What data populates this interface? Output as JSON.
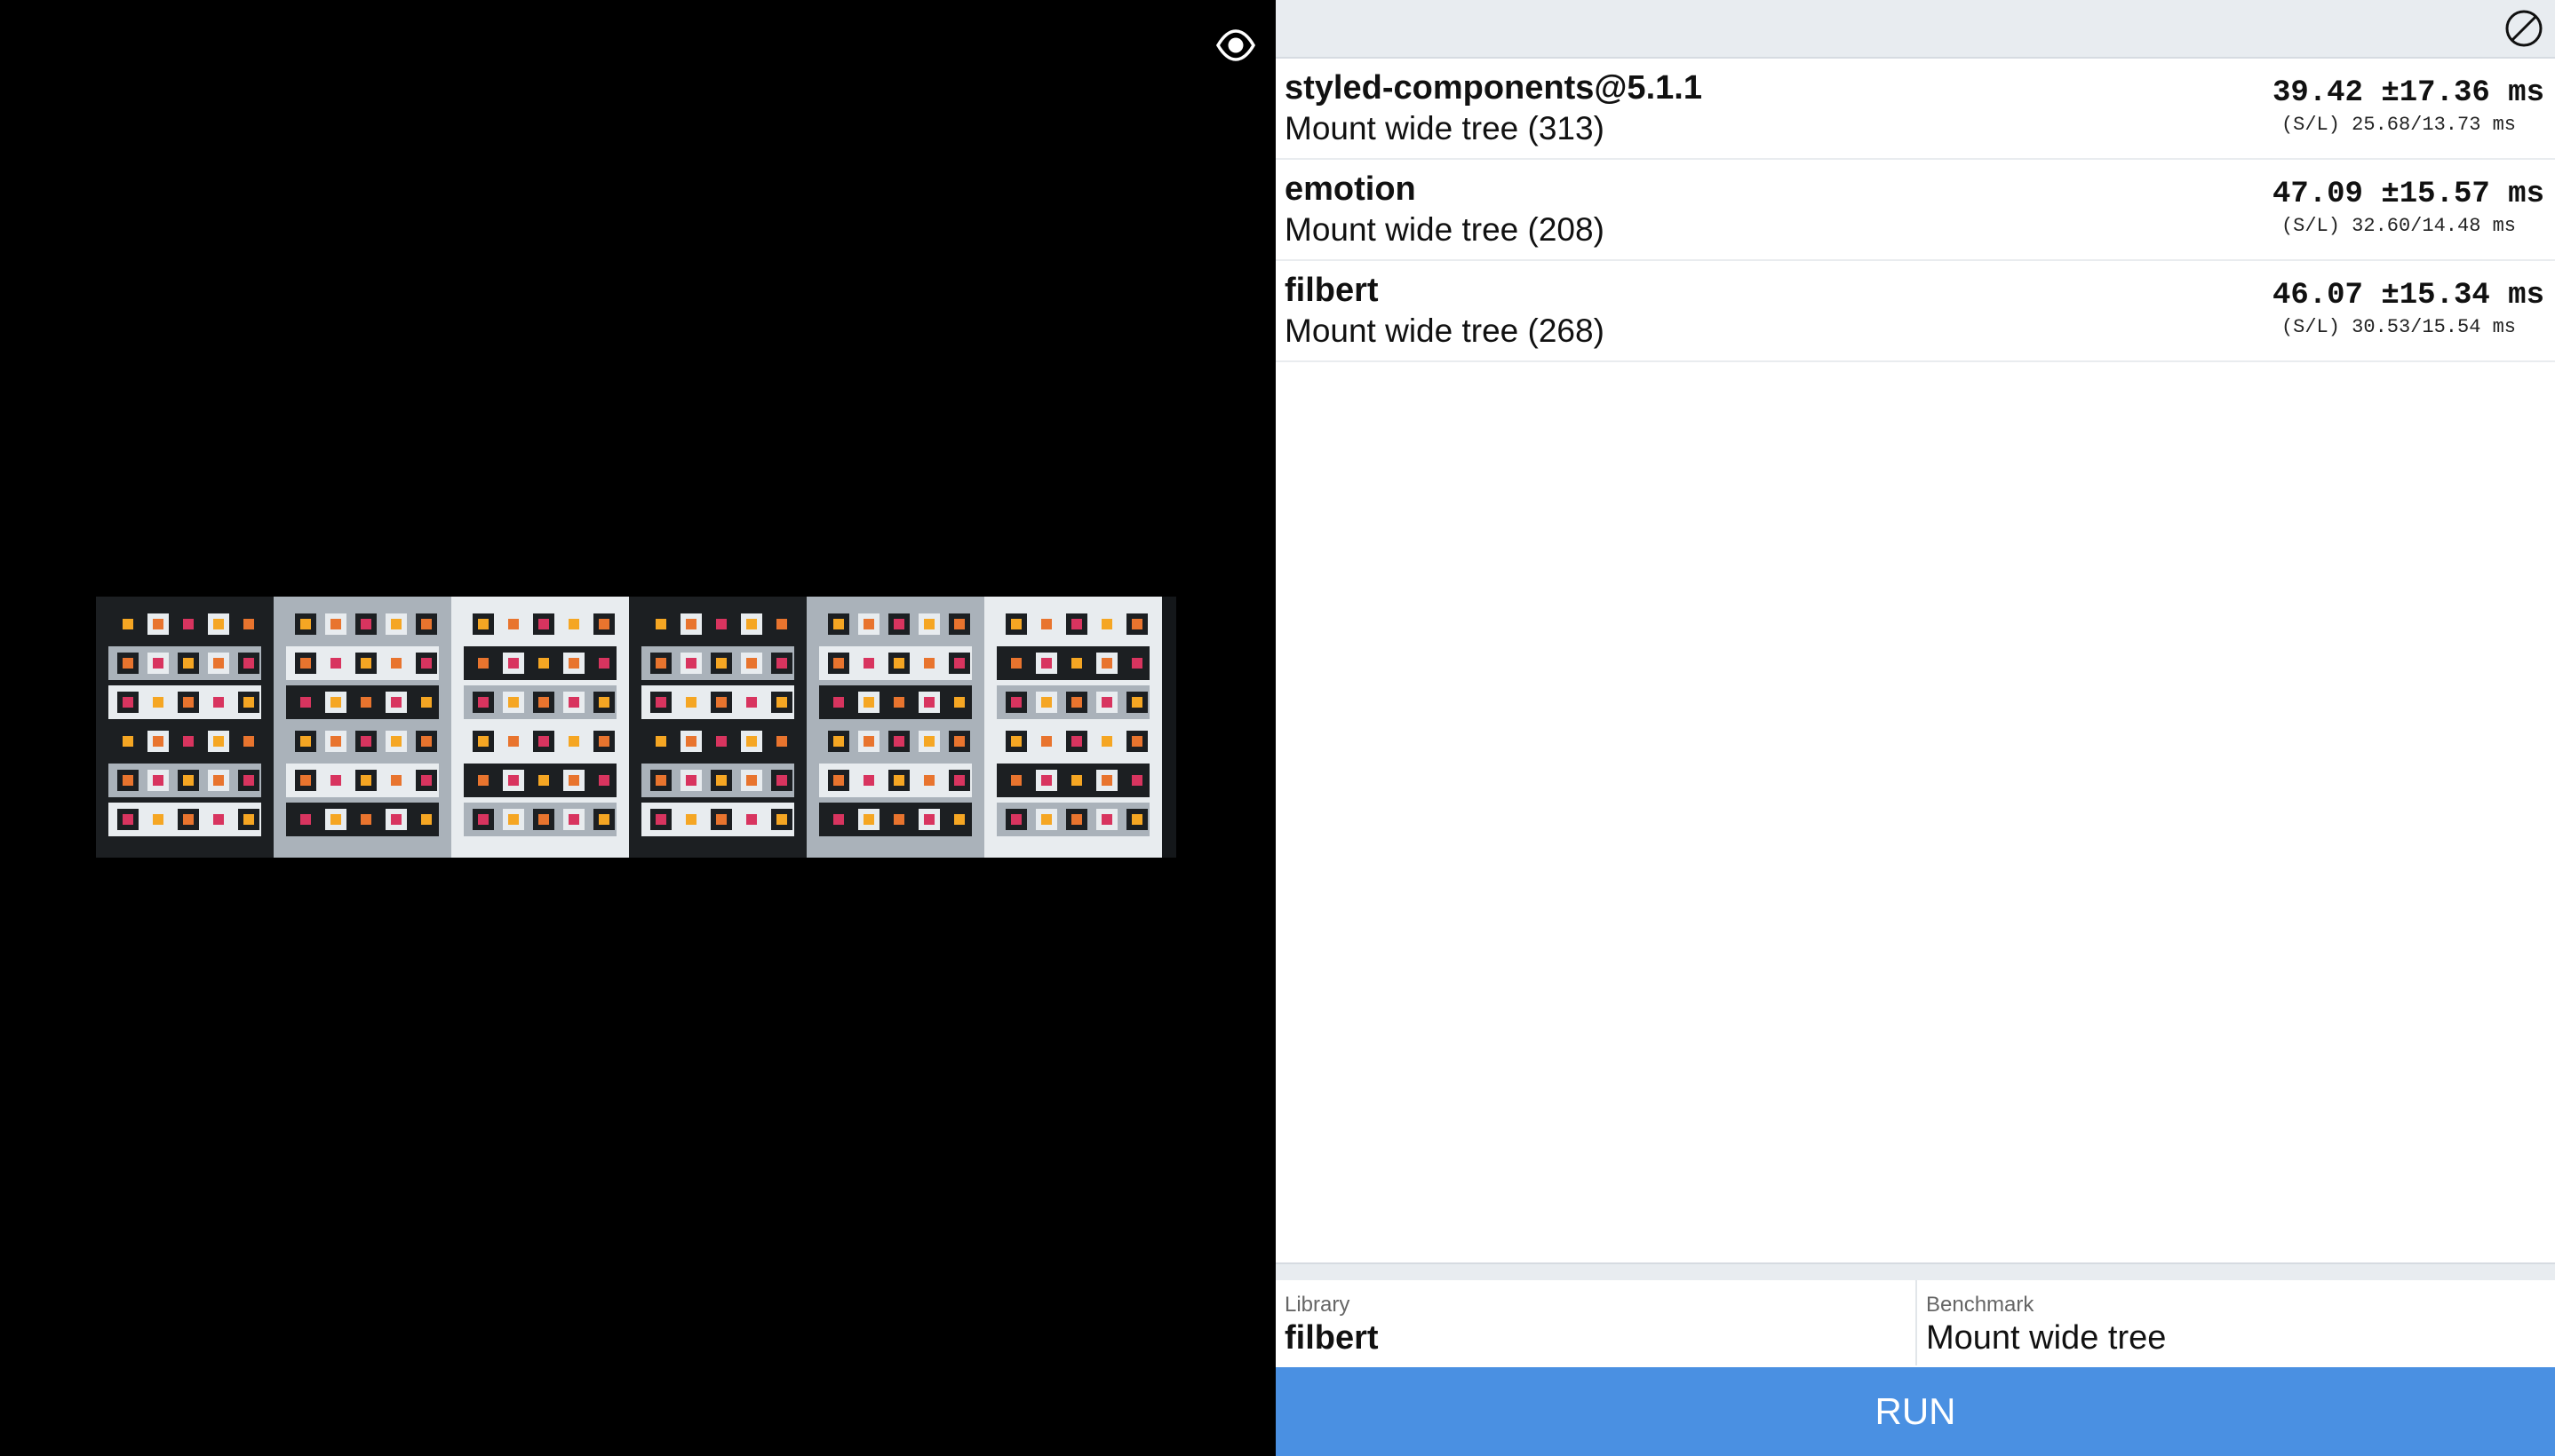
{
  "results": [
    {
      "library": "styled-components@5.1.1",
      "benchmark": "Mount wide tree (313)",
      "mean": "39.42 ±17.36 ms",
      "detail": "(S/L) 25.68/13.73 ms"
    },
    {
      "library": "emotion",
      "benchmark": "Mount wide tree (208)",
      "mean": "47.09 ±15.57 ms",
      "detail": "(S/L) 32.60/14.48 ms"
    },
    {
      "library": "filbert",
      "benchmark": "Mount wide tree (268)",
      "mean": "46.07 ±15.34 ms",
      "detail": "(S/L) 30.53/15.54 ms"
    }
  ],
  "controls": {
    "library_label": "Library",
    "library_value": "filbert",
    "benchmark_label": "Benchmark",
    "benchmark_value": "Mount wide tree",
    "run_label": "RUN"
  },
  "icons": {
    "preview_toggle": "eye-icon",
    "clear_results": "clear-icon"
  },
  "colors": {
    "run_button": "#4a90e2",
    "topbar": "#e8ecf0",
    "viz_dark": "#1c1f22",
    "viz_mid": "#aab2ba",
    "viz_light": "#e8ecef",
    "dot_yellow": "#f5a623",
    "dot_orange": "#e8742e",
    "dot_red": "#d8345f"
  }
}
